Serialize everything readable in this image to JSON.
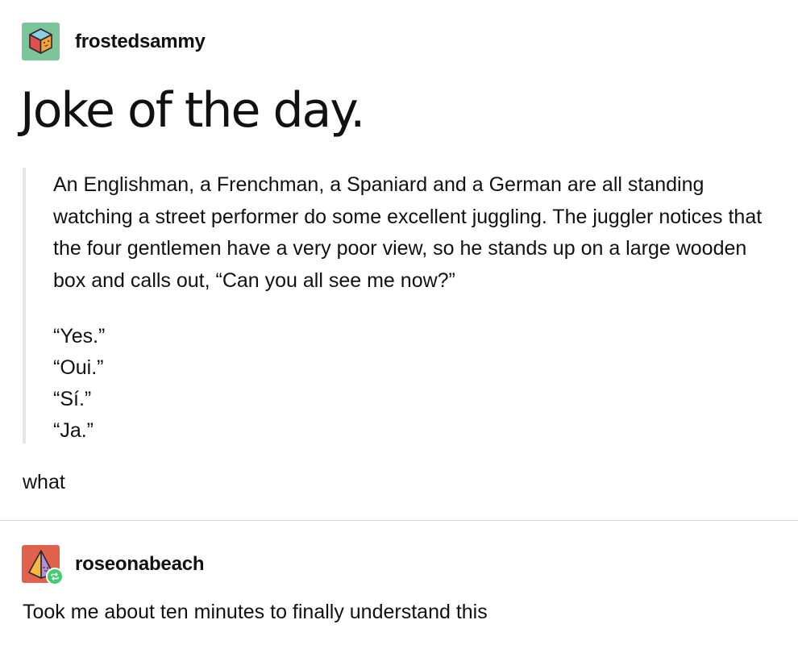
{
  "posts": [
    {
      "username": "frostedsammy",
      "avatar_icon": "cube-face-icon",
      "avatar_color": "#7cc49a",
      "title": "Joke of the day.",
      "quote": {
        "paragraph": "An Englishman, a Frenchman, a Spaniard and a German are all standing watching a street performer do some excellent juggling. The juggler notices that the four gentlemen have a very poor view, so he stands up on a large wooden box and calls out, “Can you all see me now?”",
        "answers": [
          "“Yes.”",
          "“Oui.”",
          "“Sí.”",
          "“Ja.”"
        ]
      },
      "comment": "what"
    },
    {
      "username": "roseonabeach",
      "avatar_icon": "pyramid-face-icon",
      "avatar_color": "#e0624d",
      "badge_icon": "reblog-icon",
      "badge_color": "#3fce6e",
      "comment": "Took me about ten minutes to finally understand this"
    }
  ]
}
